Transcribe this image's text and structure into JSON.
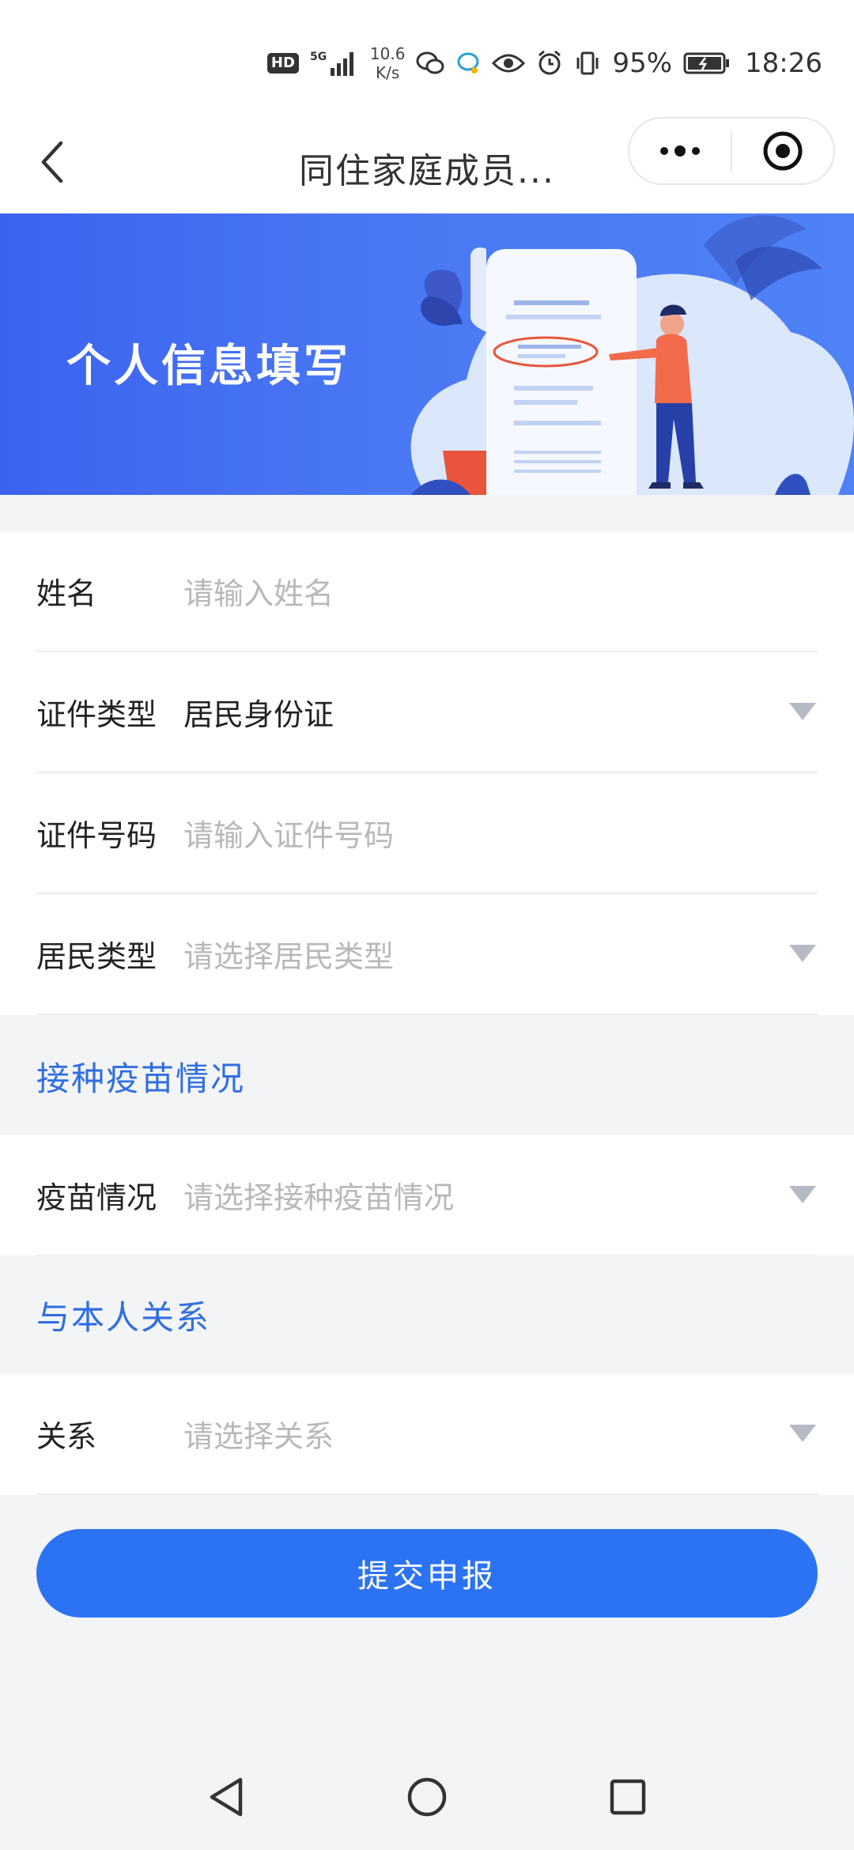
{
  "status_bar": {
    "hd": "HD",
    "net_type": "5G",
    "net_speed_value": "10.6",
    "net_speed_unit": "K/s",
    "battery": "95%",
    "time": "18:26"
  },
  "nav": {
    "title": "同住家庭成员..."
  },
  "banner": {
    "title": "个人信息填写"
  },
  "personal_info": {
    "name": {
      "label": "姓名",
      "placeholder": "请输入姓名"
    },
    "id_type": {
      "label": "证件类型",
      "value": "居民身份证"
    },
    "id_number": {
      "label": "证件号码",
      "placeholder": "请输入证件号码"
    },
    "resident_type": {
      "label": "居民类型",
      "placeholder": "请选择居民类型"
    }
  },
  "vaccine_section": {
    "title": "接种疫苗情况",
    "vaccine": {
      "label": "疫苗情况",
      "placeholder": "请选择接种疫苗情况"
    }
  },
  "relation_section": {
    "title": "与本人关系",
    "relation": {
      "label": "关系",
      "placeholder": "请选择关系"
    }
  },
  "submit_label": "提交申报",
  "colors": {
    "primary": "#2b73f3",
    "section_title": "#2f6ee0",
    "banner_start": "#3c63f0",
    "banner_end": "#4f82f6"
  }
}
